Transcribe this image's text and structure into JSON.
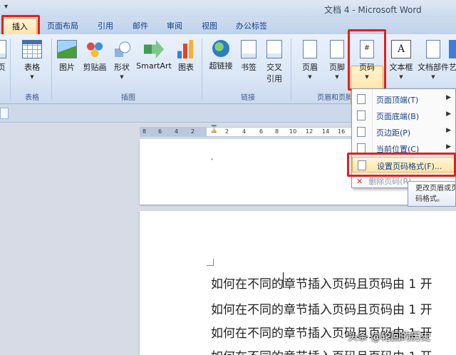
{
  "window": {
    "title": "文档 4 - Microsoft Word",
    "quick_access": "▾"
  },
  "tabs": [
    "插入",
    "页面布局",
    "引用",
    "邮件",
    "审阅",
    "视图",
    "办公标签"
  ],
  "ribbon": {
    "groups": {
      "tables": "表格",
      "illustrations": "插图",
      "links": "链接",
      "header_footer": "页眉和页脚"
    },
    "buttons": {
      "page_edge": "页",
      "table": "表格",
      "picture": "图片",
      "clipart": "剪贴画",
      "shapes": "形状",
      "smartart": "SmartArt",
      "chart": "图表",
      "hyperlink": "超链接",
      "bookmark": "书签",
      "cross_ref_1": "交叉",
      "cross_ref_2": "引用",
      "header": "页眉",
      "footer": "页脚",
      "page_number": "页码",
      "page_number_icon": "#",
      "textbox": "文本框",
      "textbox_icon": "A",
      "quick_parts": "文档部件",
      "wordart": "艺"
    }
  },
  "page_number_menu": {
    "items": [
      {
        "label": "页面顶端(T)",
        "arrow": "▶"
      },
      {
        "label": "页面底端(B)",
        "arrow": "▶"
      },
      {
        "label": "页边距(P)",
        "arrow": "▶"
      },
      {
        "label": "当前位置(C)",
        "arrow": "▶"
      },
      {
        "label": "设置页码格式(F)...",
        "arrow": ""
      }
    ],
    "delete_label": "删除页码(R)",
    "tooltip_line1": "更改页眉或页",
    "tooltip_line2": "码格式。"
  },
  "ruler": {
    "ticks": [
      "8",
      "6",
      "4",
      "2",
      "2",
      "4",
      "6",
      "8",
      "10",
      "12",
      "14",
      "16"
    ]
  },
  "document": {
    "header_mark": "'",
    "lines": [
      "如何在不同的章节插入页码且页码由 1 开",
      "如何在不同的章节插入页码且页码由 1 开",
      "如何在不同的章节插入页码且页码由 1 开",
      "如何在不同的章节插入页码且页码由 1 开"
    ]
  },
  "watermark": "头条 @轮回的历史",
  "colors": {
    "highlight_box": "#e02020",
    "ribbon_text": "#15428b"
  }
}
